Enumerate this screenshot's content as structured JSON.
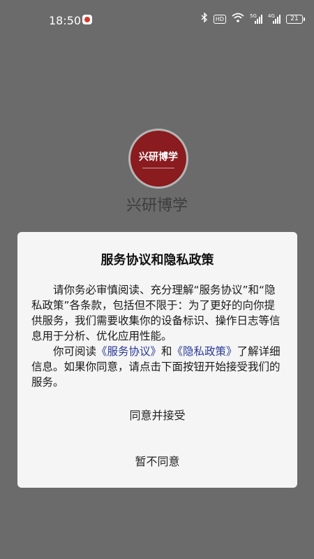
{
  "status_bar": {
    "time": "18:50",
    "hd_label": "HD",
    "net1_label": "5G",
    "net2_label": "4G",
    "battery": "21"
  },
  "app": {
    "logo_text": "兴研博学",
    "name": "兴研博学"
  },
  "dialog": {
    "title": "服务协议和隐私政策",
    "para1": "请你务必审慎阅读、充分理解“服务协议”和“隐私政策”各条款，包括但不限于：为了更好的向你提供服务，我们需要收集你的设备标识、操作日志等信息用于分析、优化应用性能。",
    "para2_prefix": "你可阅读",
    "link_service": "《服务协议》",
    "para2_and": "和",
    "link_privacy": "《隐私政策》",
    "para2_suffix": "了解详细信息。如果你同意，请点击下面按钮开始接受我们的服务。",
    "agree_button": "同意并接受",
    "decline_button": "暂不同意"
  },
  "colors": {
    "background": "#6b6b6b",
    "dialog": "#f5f5f5",
    "link": "#2a3a98",
    "logo": "#8a1b1e"
  }
}
